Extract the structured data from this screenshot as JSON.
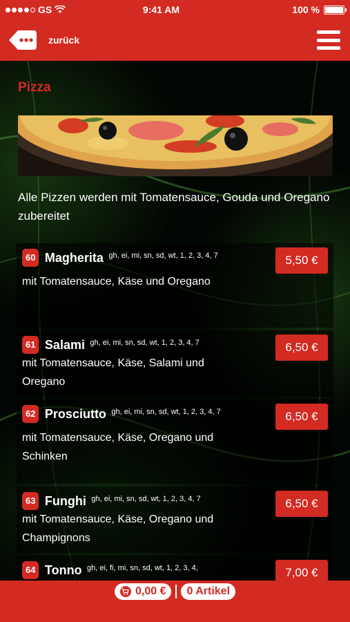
{
  "status_bar": {
    "carrier": "GS",
    "time": "9:41 AM",
    "battery": "100 %"
  },
  "header": {
    "back_label": "zurück"
  },
  "section": {
    "title": "Pizza",
    "intro": "Alle Pizzen werden mit Tomatensauce, Gouda und Oregano zubereitet"
  },
  "items": [
    {
      "number": "60",
      "name": "Magherita",
      "allergens": "gh, ei, mi, sn, sd, wt, 1, 2, 3, 4, 7",
      "description": "mit Tomatensauce, Käse und Oregano",
      "price": "5,50 €"
    },
    {
      "number": "61",
      "name": "Salami",
      "allergens": "gh, ei, mi, sn, sd, wt, 1, 2, 3, 4, 7",
      "description": "mit Tomatensauce, Käse, Salami und Oregano",
      "price": "6,50 €"
    },
    {
      "number": "62",
      "name": "Prosciutto",
      "allergens": "gh, ei, mi, sn, sd, wt, 1, 2, 3, 4, 7",
      "description": "mit Tomatensauce, Käse, Oregano und Schinken",
      "price": "6,50 €"
    },
    {
      "number": "63",
      "name": "Funghi",
      "allergens": "gh, ei, mi, sn, sd, wt, 1, 2, 3, 4, 7",
      "description": "mit Tomatensauce, Käse, Oregano und Champignons",
      "price": "6,50 €"
    },
    {
      "number": "64",
      "name": "Tonno",
      "allergens": "gh, ei, fi, mi, sn, sd, wt, 1, 2, 3, 4,",
      "description": "",
      "price": "7,00 €"
    }
  ],
  "footer": {
    "cart_total": "0,00 €",
    "article_count": "0 Artikel"
  },
  "colors": {
    "accent": "#d32a22",
    "background": "#000000"
  },
  "icons": [
    "signal-dots-icon",
    "wifi-icon",
    "battery-icon",
    "back-icon",
    "menu-icon",
    "cart-icon"
  ]
}
